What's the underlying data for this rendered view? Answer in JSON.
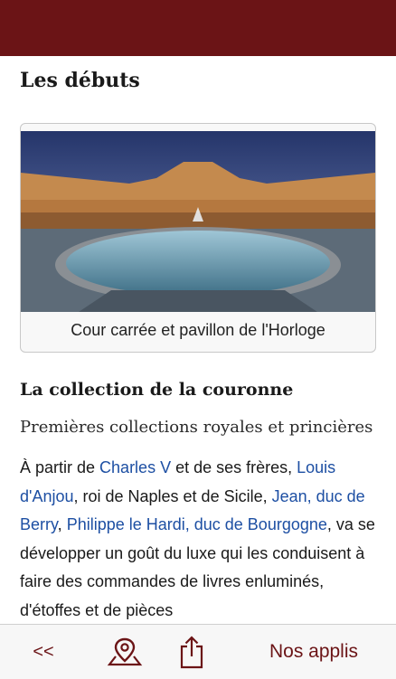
{
  "article": {
    "section_title": "Les débuts",
    "figure": {
      "caption": "Cour carrée et pavillon de l'Horloge"
    },
    "subsection_title": "La collection de la couronne",
    "lead": "Premières collections royales et princières",
    "paragraph": [
      {
        "text": "À partir de ",
        "link": false
      },
      {
        "text": "Charles V",
        "link": true
      },
      {
        "text": " et de ses frères, ",
        "link": false
      },
      {
        "text": "Louis d'Anjou",
        "link": true
      },
      {
        "text": ", roi de Naples et de Sicile, ",
        "link": false
      },
      {
        "text": "Jean, duc de Berry",
        "link": true
      },
      {
        "text": ", ",
        "link": false
      },
      {
        "text": "Philippe le Hardi, duc de Bourgogne",
        "link": true
      },
      {
        "text": ", va se développer un goût du luxe qui les conduisent à faire des commandes de livres enluminés, d'étoffes et de pièces",
        "link": false
      }
    ]
  },
  "toolbar": {
    "back_label": "<<",
    "map_icon": "map-pin-icon",
    "share_icon": "share-icon",
    "apps_label": "Nos applis"
  },
  "colors": {
    "brand": "#6b1416",
    "link": "#1d4fa3"
  }
}
